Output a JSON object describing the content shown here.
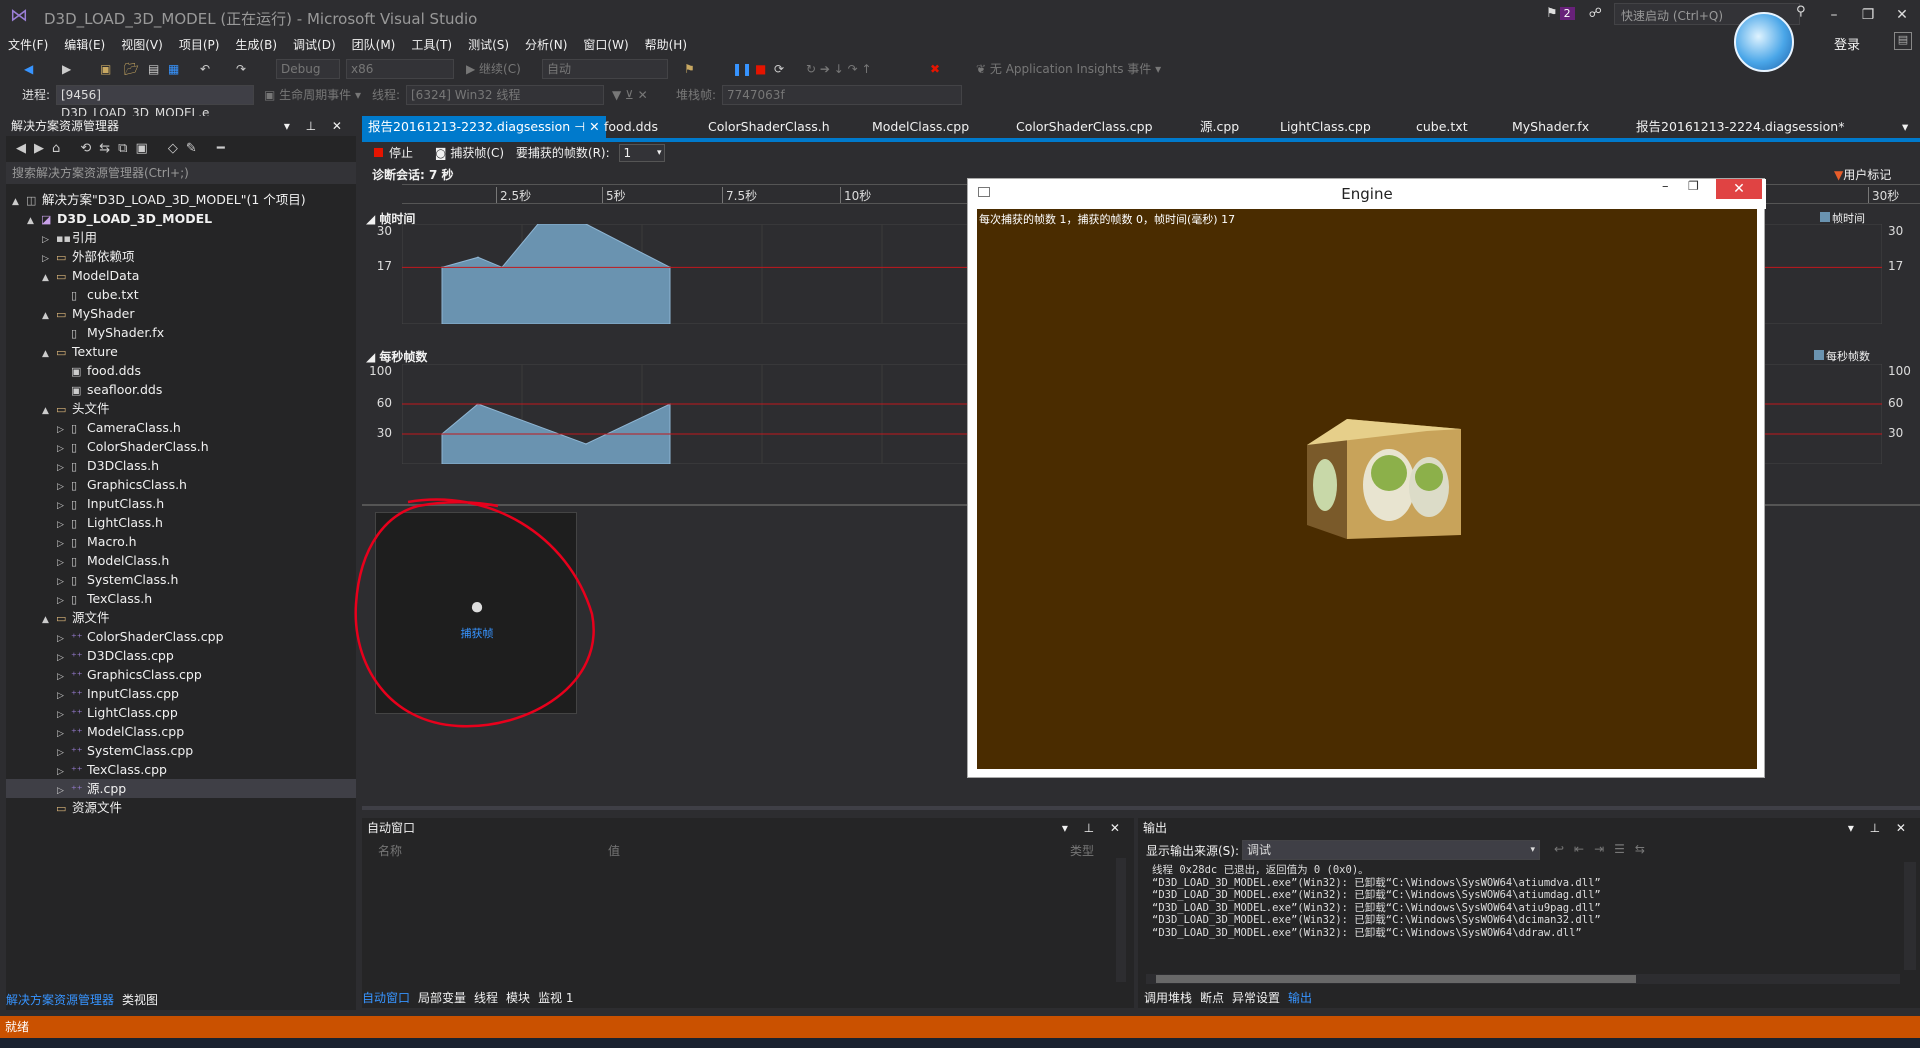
{
  "app": {
    "title": "D3D_LOAD_3D_MODEL (正在运行) - Microsoft Visual Studio",
    "notification_count": "2",
    "quick_launch_placeholder": "快速启动 (Ctrl+Q)",
    "login": "登录"
  },
  "menu": [
    "文件(F)",
    "编辑(E)",
    "视图(V)",
    "项目(P)",
    "生成(B)",
    "调试(D)",
    "团队(M)",
    "工具(T)",
    "测试(S)",
    "分析(N)",
    "窗口(W)",
    "帮助(H)"
  ],
  "toolbar1": {
    "config": "Debug",
    "platform": "x86",
    "continue": "继续(C)",
    "auto": "自动",
    "insights": "无 Application Insights 事件"
  },
  "toolbar2": {
    "process_label": "进程:",
    "process_value": "[9456] D3D_LOAD_3D_MODEL.e",
    "lifecycle": "生命周期事件",
    "thread_label": "线程:",
    "thread_value": "[6324] Win32 线程",
    "stackframe_label": "堆栈帧:",
    "stackframe_value": "7747063f"
  },
  "solution_explorer": {
    "title": "解决方案资源管理器",
    "search_placeholder": "搜索解决方案资源管理器(Ctrl+;)",
    "items": [
      {
        "label": "解决方案\"D3D_LOAD_3D_MODEL\"(1 个项目)",
        "icon": "solution-icon"
      },
      {
        "label": "D3D_LOAD_3D_MODEL",
        "icon": "project-icon"
      },
      {
        "label": "引用",
        "icon": "references-icon"
      },
      {
        "label": "外部依赖项",
        "icon": "folder-icon"
      },
      {
        "label": "ModelData",
        "icon": "folder-icon"
      },
      {
        "label": "cube.txt",
        "icon": "file-icon"
      },
      {
        "label": "MyShader",
        "icon": "folder-icon"
      },
      {
        "label": "MyShader.fx",
        "icon": "file-icon"
      },
      {
        "label": "Texture",
        "icon": "folder-icon"
      },
      {
        "label": "food.dds",
        "icon": "image-file-icon"
      },
      {
        "label": "seafloor.dds",
        "icon": "image-file-icon"
      },
      {
        "label": "头文件",
        "icon": "folder-icon"
      },
      {
        "label": "CameraClass.h",
        "icon": "header-file-icon"
      },
      {
        "label": "ColorShaderClass.h",
        "icon": "header-file-icon"
      },
      {
        "label": "D3DClass.h",
        "icon": "header-file-icon"
      },
      {
        "label": "GraphicsClass.h",
        "icon": "header-file-icon"
      },
      {
        "label": "InputClass.h",
        "icon": "header-file-icon"
      },
      {
        "label": "LightClass.h",
        "icon": "header-file-icon"
      },
      {
        "label": "Macro.h",
        "icon": "header-file-icon"
      },
      {
        "label": "ModelClass.h",
        "icon": "header-file-icon"
      },
      {
        "label": "SystemClass.h",
        "icon": "header-file-icon"
      },
      {
        "label": "TexClass.h",
        "icon": "header-file-icon"
      },
      {
        "label": "源文件",
        "icon": "folder-icon"
      },
      {
        "label": "ColorShaderClass.cpp",
        "icon": "cpp-file-icon"
      },
      {
        "label": "D3DClass.cpp",
        "icon": "cpp-file-icon"
      },
      {
        "label": "GraphicsClass.cpp",
        "icon": "cpp-file-icon"
      },
      {
        "label": "InputClass.cpp",
        "icon": "cpp-file-icon"
      },
      {
        "label": "LightClass.cpp",
        "icon": "cpp-file-icon"
      },
      {
        "label": "ModelClass.cpp",
        "icon": "cpp-file-icon"
      },
      {
        "label": "SystemClass.cpp",
        "icon": "cpp-file-icon"
      },
      {
        "label": "TexClass.cpp",
        "icon": "cpp-file-icon"
      },
      {
        "label": "源.cpp",
        "icon": "cpp-file-icon"
      },
      {
        "label": "资源文件",
        "icon": "folder-icon"
      }
    ],
    "bottom_tabs": [
      "解决方案资源管理器",
      "类视图"
    ]
  },
  "doc_tabs": [
    "报告20161213-2232.diagsession",
    "food.dds",
    "ColorShaderClass.h",
    "ModelClass.cpp",
    "ColorShaderClass.cpp",
    "源.cpp",
    "LightClass.cpp",
    "cube.txt",
    "MyShader.fx",
    "报告20161213-2224.diagsession*"
  ],
  "diag": {
    "stop": "停止",
    "capture": "捕获帧(C)",
    "frames_label": "要捕获的帧数(R):",
    "frames_value": "1",
    "session": "诊断会话: 7 秒",
    "user_marks": "用户标记",
    "ruler_ticks": [
      "2.5秒",
      "5秒",
      "7.5秒",
      "10秒",
      "30秒"
    ],
    "capture_caption": "捕获帧",
    "frame_time_label": "帧时间",
    "fps_label": "每秒帧数"
  },
  "chart_data": [
    {
      "type": "area",
      "title": "帧时间",
      "x": [
        0,
        0.3,
        0.5,
        0.8,
        1.2,
        1.9
      ],
      "values": [
        17,
        20,
        17,
        30,
        30,
        17
      ],
      "yticks": [
        17,
        30
      ],
      "ylim": [
        0,
        30
      ],
      "reference_lines": [
        17
      ],
      "color": "#6a93b0"
    },
    {
      "type": "area",
      "title": "每秒帧数",
      "x": [
        0,
        0.3,
        1.2,
        1.9
      ],
      "values": [
        30,
        60,
        20,
        60
      ],
      "yticks": [
        30,
        60,
        100
      ],
      "ylim": [
        0,
        100
      ],
      "reference_lines": [
        30,
        60
      ],
      "color": "#6a93b0"
    }
  ],
  "engine": {
    "title": "Engine",
    "hud": "每次捕获的帧数 1，捕获的帧数 0，帧时间(毫秒) 17"
  },
  "auto_window": {
    "title": "自动窗口",
    "col_name": "名称",
    "col_value": "值",
    "col_type": "类型",
    "tabs": [
      "自动窗口",
      "局部变量",
      "线程",
      "模块",
      "监视 1"
    ]
  },
  "output": {
    "title": "输出",
    "source_label": "显示输出来源(S):",
    "source_value": "调试",
    "lines": [
      "线程 0x28dc 已退出，返回值为 0 (0x0)。",
      "“D3D_LOAD_3D_MODEL.exe”(Win32): 已卸载“C:\\Windows\\SysWOW64\\atiumdva.dll”",
      "“D3D_LOAD_3D_MODEL.exe”(Win32): 已卸载“C:\\Windows\\SysWOW64\\atiumdag.dll”",
      "“D3D_LOAD_3D_MODEL.exe”(Win32): 已卸载“C:\\Windows\\SysWOW64\\atiu9pag.dll”",
      "“D3D_LOAD_3D_MODEL.exe”(Win32): 已卸载“C:\\Windows\\SysWOW64\\dciman32.dll”",
      "“D3D_LOAD_3D_MODEL.exe”(Win32): 已卸载“C:\\Windows\\SysWOW64\\ddraw.dll”"
    ],
    "tabs": [
      "调用堆栈",
      "断点",
      "异常设置",
      "输出"
    ]
  },
  "status": "就绪"
}
